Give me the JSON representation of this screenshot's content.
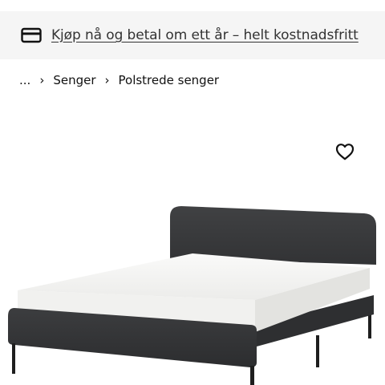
{
  "promo": {
    "icon": "credit-card-icon",
    "text": "Kjøp nå og betal om ett år – helt kostnadsfritt"
  },
  "breadcrumb": {
    "ellipsis": "...",
    "items": [
      "Senger",
      "Polstrede senger"
    ]
  },
  "product": {
    "favorite_icon": "heart-icon",
    "image_subject": "upholstered bed frame, dark grey fabric with white mattress",
    "colors": {
      "fabric": "#3a3b3d",
      "mattress": "#f4f4f2",
      "legs": "#1e1e1e"
    }
  }
}
